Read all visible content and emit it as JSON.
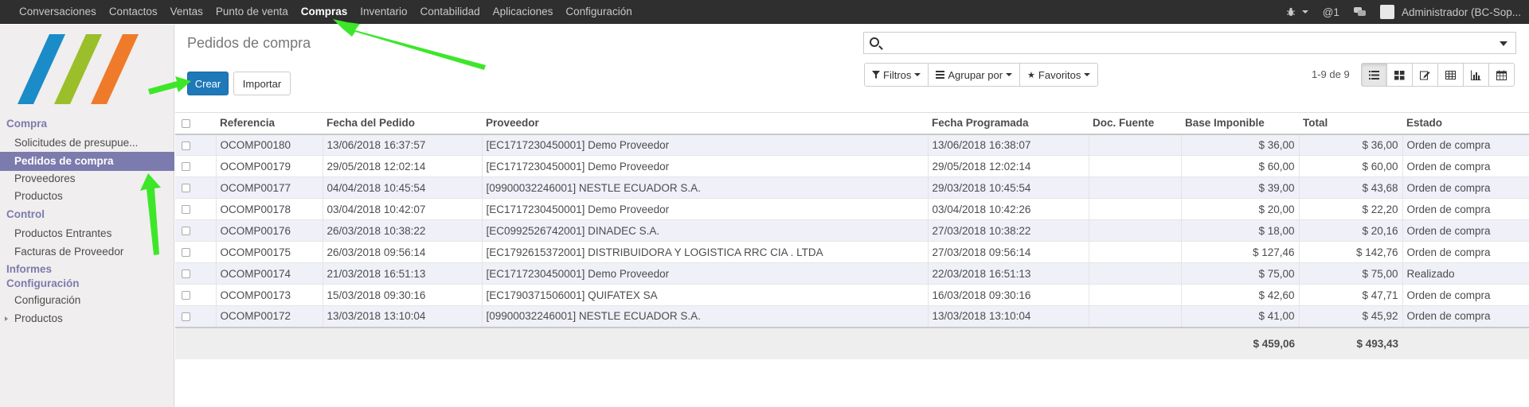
{
  "topnav": {
    "items": [
      "Conversaciones",
      "Contactos",
      "Ventas",
      "Punto de venta",
      "Compras",
      "Inventario",
      "Contabilidad",
      "Aplicaciones",
      "Configuración"
    ],
    "active": "Compras",
    "messages_count": "@1",
    "user": "Administrador (BC-Sop..."
  },
  "sidebar": {
    "section_compra": "Compra",
    "compra_items": [
      "Solicitudes de presupue...",
      "Pedidos de compra",
      "Proveedores",
      "Productos"
    ],
    "active_item": "Pedidos de compra",
    "section_control": "Control",
    "control_items": [
      "Productos Entrantes",
      "Facturas de Proveedor"
    ],
    "section_informes": "Informes",
    "section_config": "Configuración",
    "config_items": [
      "Configuración",
      "Productos"
    ]
  },
  "control_panel": {
    "title": "Pedidos de compra",
    "create_label": "Crear",
    "import_label": "Importar",
    "search_placeholder": "",
    "filters_label": "Filtros",
    "groupby_label": "Agrupar por",
    "favorites_label": "Favoritos",
    "pager": "1-9 de 9",
    "view_icons": [
      "list-view-icon",
      "kanban-view-icon",
      "form-view-icon",
      "pivot-view-icon",
      "graph-view-icon",
      "calendar-view-icon"
    ]
  },
  "table": {
    "columns": [
      "Referencia",
      "Fecha del Pedido",
      "Proveedor",
      "Fecha Programada",
      "Doc. Fuente",
      "Base Imponible",
      "Total",
      "Estado"
    ],
    "rows": [
      {
        "ref": "OCOMP00180",
        "date": "13/06/2018 16:37:57",
        "vendor": "[EC1717230450001] Demo Proveedor",
        "scheduled": "13/06/2018 16:38:07",
        "source": "",
        "base": "$ 36,00",
        "total": "$ 36,00",
        "state": "Orden de compra"
      },
      {
        "ref": "OCOMP00179",
        "date": "29/05/2018 12:02:14",
        "vendor": "[EC1717230450001] Demo Proveedor",
        "scheduled": "29/05/2018 12:02:14",
        "source": "",
        "base": "$ 60,00",
        "total": "$ 60,00",
        "state": "Orden de compra"
      },
      {
        "ref": "OCOMP00177",
        "date": "04/04/2018 10:45:54",
        "vendor": "[09900032246001] NESTLE ECUADOR S.A.",
        "scheduled": "29/03/2018 10:45:54",
        "source": "",
        "base": "$ 39,00",
        "total": "$ 43,68",
        "state": "Orden de compra"
      },
      {
        "ref": "OCOMP00178",
        "date": "03/04/2018 10:42:07",
        "vendor": "[EC1717230450001] Demo Proveedor",
        "scheduled": "03/04/2018 10:42:26",
        "source": "",
        "base": "$ 20,00",
        "total": "$ 22,20",
        "state": "Orden de compra"
      },
      {
        "ref": "OCOMP00176",
        "date": "26/03/2018 10:38:22",
        "vendor": "[EC0992526742001] DINADEC S.A.",
        "scheduled": "27/03/2018 10:38:22",
        "source": "",
        "base": "$ 18,00",
        "total": "$ 20,16",
        "state": "Orden de compra"
      },
      {
        "ref": "OCOMP00175",
        "date": "26/03/2018 09:56:14",
        "vendor": "[EC1792615372001] DISTRIBUIDORA Y LOGISTICA RRC CIA . LTDA",
        "scheduled": "27/03/2018 09:56:14",
        "source": "",
        "base": "$ 127,46",
        "total": "$ 142,76",
        "state": "Orden de compra"
      },
      {
        "ref": "OCOMP00174",
        "date": "21/03/2018 16:51:13",
        "vendor": "[EC1717230450001] Demo Proveedor",
        "scheduled": "22/03/2018 16:51:13",
        "source": "",
        "base": "$ 75,00",
        "total": "$ 75,00",
        "state": "Realizado"
      },
      {
        "ref": "OCOMP00173",
        "date": "15/03/2018 09:30:16",
        "vendor": "[EC1790371506001] QUIFATEX SA",
        "scheduled": "16/03/2018 09:30:16",
        "source": "",
        "base": "$ 42,60",
        "total": "$ 47,71",
        "state": "Orden de compra"
      },
      {
        "ref": "OCOMP00172",
        "date": "13/03/2018 13:10:04",
        "vendor": "[09900032246001] NESTLE ECUADOR S.A.",
        "scheduled": "13/03/2018 13:10:04",
        "source": "",
        "base": "$ 41,00",
        "total": "$ 45,92",
        "state": "Orden de compra"
      }
    ],
    "footer": {
      "base_total": "$ 459,06",
      "total_total": "$ 493,43"
    }
  },
  "colors": {
    "topbar": "#2f2f2f",
    "sidebar_accent": "#7c7bad",
    "create_button": "#1f79b8",
    "row_stripe": "#eff0f8",
    "annotation_arrow": "#3ee62a",
    "logo": [
      "#1a8cc8",
      "#9bbf2a",
      "#ef7b2a"
    ]
  }
}
